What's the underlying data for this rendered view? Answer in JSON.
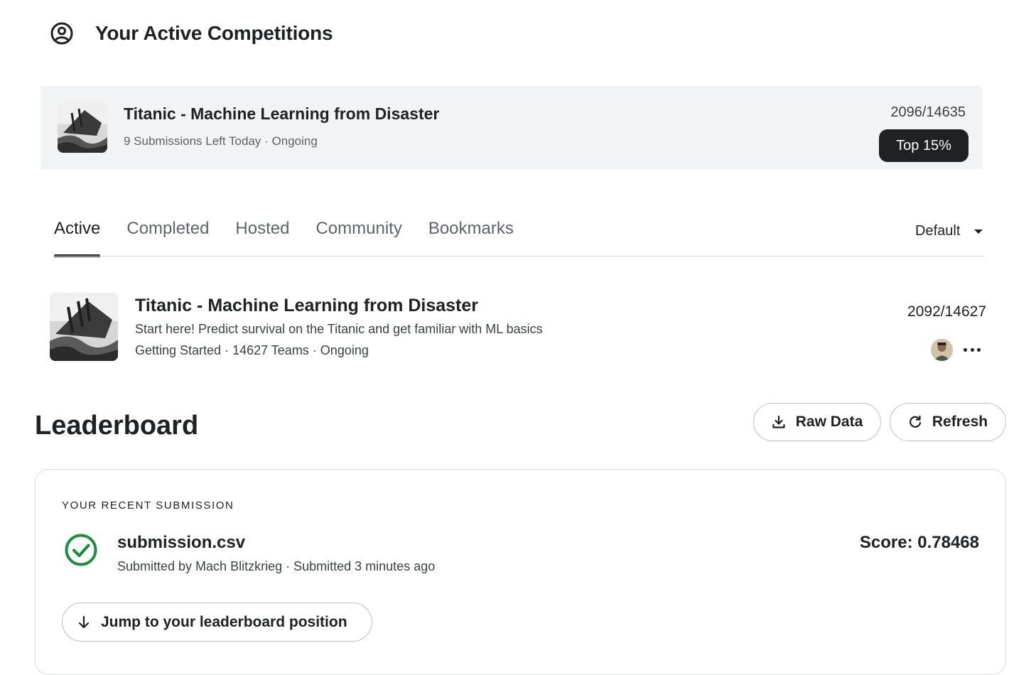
{
  "header": {
    "title": "Your Active Competitions",
    "icon": "user-circle-icon"
  },
  "active_competition": {
    "title": "Titanic - Machine Learning from Disaster",
    "subtitle": "9 Submissions Left Today · Ongoing",
    "rank": "2096/14635",
    "badge": "Top 15%"
  },
  "tabs": [
    {
      "label": "Active",
      "selected": true
    },
    {
      "label": "Completed",
      "selected": false
    },
    {
      "label": "Hosted",
      "selected": false
    },
    {
      "label": "Community",
      "selected": false
    },
    {
      "label": "Bookmarks",
      "selected": false
    }
  ],
  "sort": {
    "selected": "Default"
  },
  "competition_list": [
    {
      "title": "Titanic - Machine Learning from Disaster",
      "description": "Start here! Predict survival on the Titanic and get familiar with ML basics",
      "meta": "Getting Started · 14627 Teams · Ongoing",
      "rank": "2092/14627"
    }
  ],
  "leaderboard": {
    "title": "Leaderboard",
    "raw_data_label": "Raw Data",
    "refresh_label": "Refresh",
    "recent_submission": {
      "section_label": "YOUR RECENT SUBMISSION",
      "filename": "submission.csv",
      "submitted_by": "Submitted by Mach Blitzkrieg · Submitted 3 minutes ago",
      "score": "Score: 0.78468",
      "jump_label": "Jump to your leaderboard position"
    }
  },
  "colors": {
    "text_primary": "#202124",
    "text_secondary": "#5f6368",
    "success_green": "#1e8e3e",
    "card_bg": "#f1f3f4",
    "badge_bg": "#202124"
  }
}
